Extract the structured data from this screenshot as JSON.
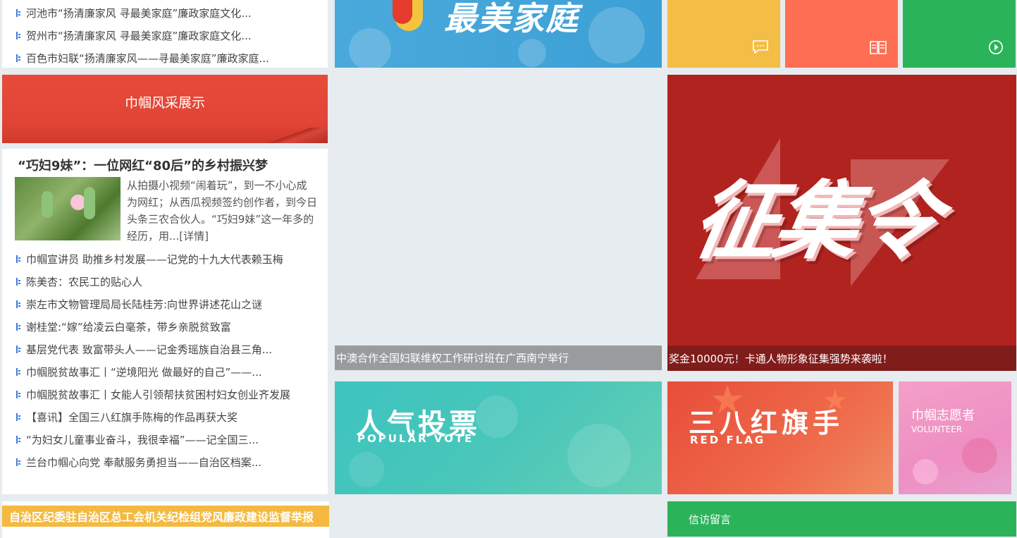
{
  "top_list": [
    "河池市“扬清廉家风 寻最美家庭”廉政家庭文化...",
    "贺州市“扬清廉家风 寻最美家庭”廉政家庭文化...",
    "百色市妇联“扬清廉家风——寻最美家庭”廉政家庭..."
  ],
  "banner_jinguo": "巾帼风采展示",
  "feature": {
    "title": "“巧妇9妹”：一位网红“80后”的乡村振兴梦",
    "text": "从拍摄小视频“闹着玩”，到一不小心成为网红；从西瓜视频签约创作者，到今日头条三农合伙人。“巧妇9妹”这一年多的经历，用...[详情]"
  },
  "news_list": [
    "巾帼宣讲员 助推乡村发展——记党的十九大代表赖玉梅",
    "陈美杏：农民工的贴心人",
    "崇左市文物管理局局长陆桂芳:向世界讲述花山之谜",
    "谢桂堂:“嫁”给凌云白毫茶，带乡亲脱贫致富",
    "基层党代表 致富带头人——记金秀瑶族自治县三角...",
    "巾帼脱贫故事汇丨“逆境阳光 做最好的自己”——...",
    "巾帼脱贫故事汇丨女能人引领帮扶贫困村妇女创业齐发展",
    "【喜讯】全国三八红旗手陈梅的作品再获大奖",
    "“为妇女儿童事业奋斗，我很幸福”——记全国三...",
    "兰台巾帼心向党 奉献服务勇担当——自治区档案..."
  ],
  "yellow_bar": "自治区纪委驻自治区总工会机关纪检组党风廉政建设监督举报",
  "top_banner_text": "最美家庭",
  "center_caption": "中澳合作全国妇联维权工作研讨班在广西南宁举行",
  "vote": {
    "title": "人气投票",
    "subtitle": "POPULAR VOTE"
  },
  "tiles": [
    {
      "icon": "chat-icon",
      "color": "#f4bd45"
    },
    {
      "icon": "book-icon",
      "color": "#fd6e52"
    },
    {
      "icon": "play-icon",
      "color": "#2bb35a"
    }
  ],
  "zhengji": {
    "art_text": "征集令",
    "caption": "奖金10000元！卡通人物形象征集强势来袭啦！"
  },
  "redflag": {
    "title": "三八红旗手",
    "subtitle": "RED FLAG"
  },
  "volunteer": {
    "title": "巾帼志愿者",
    "subtitle": "VOLUNTEER"
  },
  "green_bar": "信访留言"
}
